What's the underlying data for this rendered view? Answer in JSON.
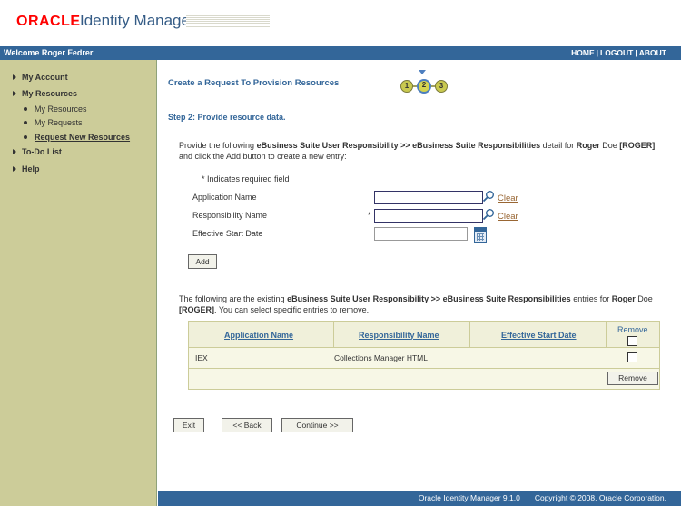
{
  "header": {
    "brand": "ORACLE",
    "product": "Identity Manager",
    "welcome": "Welcome Roger Fedrer",
    "links": [
      "HOME",
      "LOGOUT",
      "ABOUT"
    ]
  },
  "sidebar": {
    "items": [
      {
        "label": "My Account"
      },
      {
        "label": "My Resources",
        "children": [
          "My Resources",
          "My Requests",
          "Request New Resources"
        ]
      },
      {
        "label": "To-Do List"
      },
      {
        "label": "Help"
      }
    ]
  },
  "main": {
    "title": "Create a Request To Provision Resources",
    "steps": [
      "1",
      "2",
      "3"
    ],
    "step_heading": "Step 2:  Provide resource data.",
    "instruction": {
      "part1": "Provide the following ",
      "bold1": "eBusiness Suite User Responsibility >> eBusiness Suite Responsibilities",
      "part2": " detail for ",
      "bold2": "Roger",
      "part3": " Doe ",
      "bold3": "[ROGER]",
      "part4": " and click the Add button to create a new entry:"
    },
    "required_note": "* Indicates required field",
    "fields": {
      "application_name": {
        "label": "Application Name",
        "value": "",
        "clear": "Clear"
      },
      "responsibility_name": {
        "label": "Responsibility Name",
        "required": "*",
        "value": "",
        "clear": "Clear"
      },
      "effective_start_date": {
        "label": "Effective Start Date",
        "value": ""
      }
    },
    "add_button": "Add",
    "table_instruction": {
      "part1": "The following are the existing ",
      "bold1": "eBusiness Suite User Responsibility >> eBusiness Suite Responsibilities",
      "part2": " entries for ",
      "bold2": "Roger",
      "part3": " Doe ",
      "bold3": "[ROGER]",
      "part4": ". You can select specific entries to remove."
    },
    "table": {
      "columns": [
        "Application Name",
        "Responsibility Name",
        "Effective Start Date",
        "Remove"
      ],
      "rows": [
        {
          "application": "IEX",
          "responsibility": "Collections Manager HTML",
          "start_date": ""
        }
      ],
      "remove_button": "Remove"
    },
    "nav_buttons": {
      "exit": "Exit",
      "back": "<< Back",
      "continue": "Continue >>"
    }
  },
  "footer": {
    "version": "Oracle Identity Manager 9.1.0",
    "copyright": "Copyright © 2008, Oracle Corporation."
  },
  "colors": {
    "nav_blue": "#336699",
    "sidebar": "#cccc99",
    "link_brown": "#996633"
  }
}
